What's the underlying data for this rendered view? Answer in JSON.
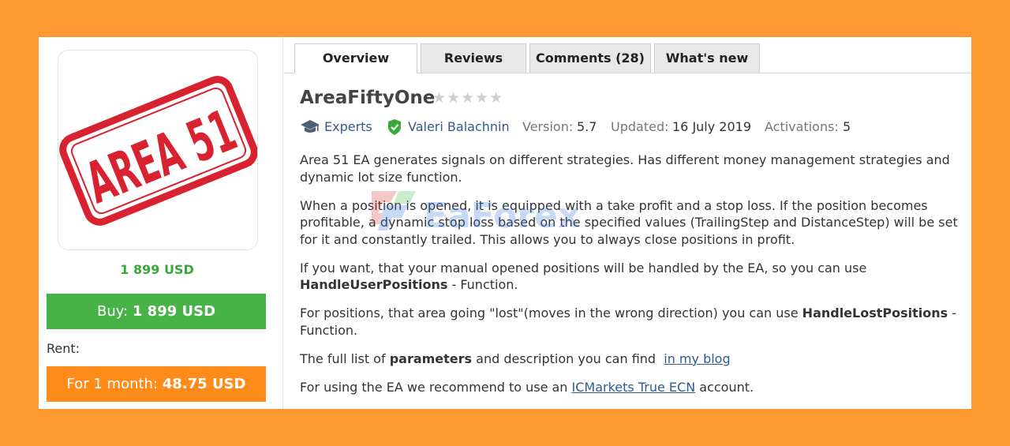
{
  "product": {
    "logo_text": "AREA 51",
    "price": "1 899 USD",
    "buy_prefix": "Buy:",
    "buy_amount": "1 899 USD",
    "rent_label": "Rent:",
    "rent_prefix": "For 1 month:",
    "rent_amount": "48.75 USD"
  },
  "tabs": [
    {
      "label": "Overview",
      "active": true
    },
    {
      "label": "Reviews",
      "active": false
    },
    {
      "label": "Comments (28)",
      "active": false
    },
    {
      "label": "What's new",
      "active": false
    }
  ],
  "header": {
    "title": "AreaFiftyOne",
    "rating_stars": 0,
    "stars_glyph": "★★★★★"
  },
  "meta": {
    "category": "Experts",
    "author": "Valeri Balachnin",
    "version_label": "Version:",
    "version": "5.7",
    "updated_label": "Updated:",
    "updated": "16 July 2019",
    "activations_label": "Activations:",
    "activations": "5"
  },
  "description": {
    "p1": "Area 51 EA generates signals on different strategies. Has different money management strategies and dynamic lot size function.",
    "p2": "When a position is opened, it is equipped with a take profit and a stop loss. If the position becomes profitable, a dynamic stop loss based on the specified values (TrailingStep and DistanceStep) will be set for it and constantly trailed. This allows you to always close positions in profit.",
    "p3_a": "If you want, that your manual opened positions will be handled by the EA, so you can use ",
    "p3_b": "HandleUserPositions",
    "p3_c": " - Function.",
    "p4_a": "For positions, that area going \"lost\"(moves in the wrong direction) you can use ",
    "p4_b": "HandleLostPositions",
    "p4_c": " - Function.",
    "p5_a": "The full list of ",
    "p5_b": "parameters",
    "p5_c": " and description you can find  ",
    "p5_link": "in my blog",
    "p6_a": "For using the EA we recommend to use an ",
    "p6_link": "ICMarkets True ECN",
    "p6_c": " account."
  },
  "watermark": "EaForex",
  "colors": {
    "page_bg": "#ff9a33",
    "buy_green": "#47b347",
    "rent_orange": "#ff8c1a",
    "link_blue": "#2f5b8f",
    "logo_red": "#d8222f"
  }
}
